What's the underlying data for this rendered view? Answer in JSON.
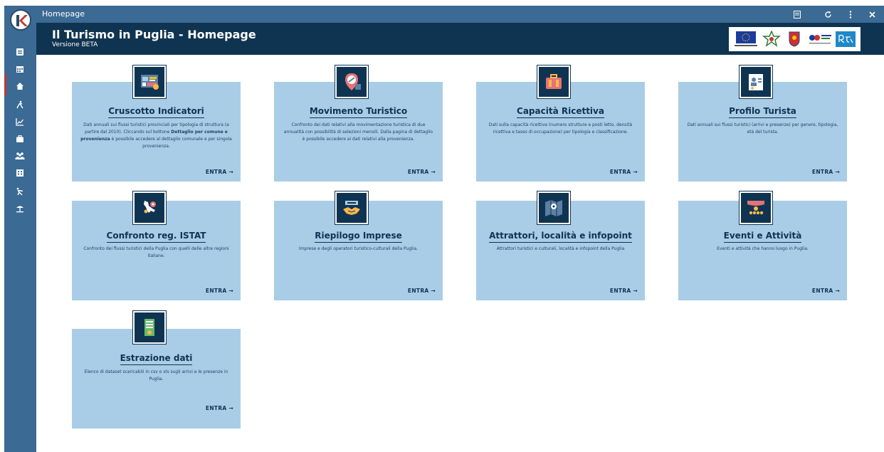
{
  "window": {
    "title": "Homepage"
  },
  "header": {
    "title": "Il Turismo in Puglia - Homepage",
    "subtitle": "Versione BETA"
  },
  "colors": {
    "sidebar": "#3b6a94",
    "header": "#0f3451",
    "card": "#a9cde6",
    "accent": "#c0392b"
  },
  "sidebar_icons": [
    "home-doc-icon",
    "calendar-icon",
    "home-icon",
    "walker-icon",
    "chart-icon",
    "briefcase-icon",
    "people-icon",
    "building-icon",
    "hiking-icon",
    "beach-icon"
  ],
  "cards": [
    {
      "title": "Cruscotto Indicatori",
      "desc_pre": "Dati annuali sui flussi turistici provinciali per tipologia di struttura (a partire dal 2010). Cliccando sul bottone ",
      "desc_bold": "Dettaglio per comune e provenienza",
      "desc_post": " è possibile accedere al dettaglio comunale e per singola provenienza.",
      "enter": "ENTRA →"
    },
    {
      "title": "Movimento Turistico",
      "desc": "Confronto dei dati relativi alla movimentazione turistica di due annualità con possibilità di selezioni mensili. Dalla pagina di dettaglio è possibile accedere ai dati relativi alla provenienza.",
      "enter": "ENTRA →"
    },
    {
      "title": "Capacità Ricettiva",
      "desc": "Dati sulla capacità ricettiva (numero strutture e posti letto, densità ricettiva e tasso di occupazione) per tipologia e classificazione.",
      "enter": "ENTRA →"
    },
    {
      "title": "Profilo Turista",
      "desc": "Dati annuali sui flussi turistici (arrivi e presenze) per genere, tipologia, età del turista.",
      "enter": "ENTRA →"
    },
    {
      "title": "Confronto reg. ISTAT",
      "desc": "Confronto dei flussi turistici della Puglia con quelli delle altre regioni italiane.",
      "enter": "ENTRA →"
    },
    {
      "title": "Riepilogo Imprese",
      "desc": "Imprese e degli operatori turistico-culturali della Puglia.",
      "enter": "ENTRA →"
    },
    {
      "title": "Attrattori, località e infopoint",
      "desc": "Attrattori turistici e culturali, località e infopoint della Puglia",
      "enter": "ENTRA →"
    },
    {
      "title": "Eventi e Attività",
      "desc": "Eventi e attività che hanno luogo in Puglia.",
      "enter": "ENTRA →"
    },
    {
      "title": "Estrazione dati",
      "desc": "Elenco di dataset scaricabili in csv o xls sugli arrivi e le presenze in Puglia.",
      "enter": "ENTRA →"
    }
  ]
}
